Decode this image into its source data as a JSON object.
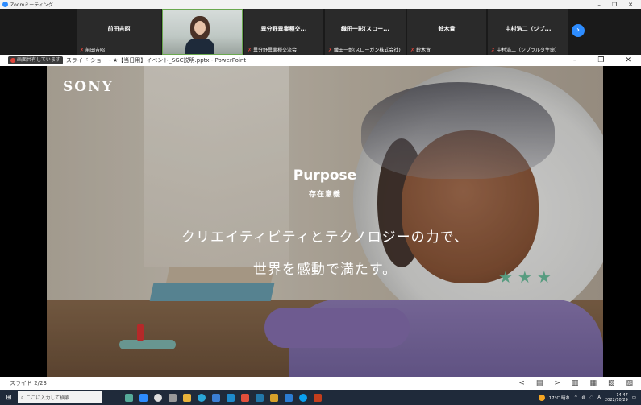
{
  "zoom": {
    "title": "Zoomミーティング",
    "window_controls": [
      "–",
      "❐",
      "✕"
    ],
    "participants": [
      {
        "name": "前田吉昭",
        "footer": "前田吉昭",
        "video": false
      },
      {
        "name": "",
        "footer": "",
        "video": true
      },
      {
        "name": "異分野異業種交...",
        "footer": "異分野異業種交流会",
        "video": false
      },
      {
        "name": "織田一彰(スロー...",
        "footer": "織田一彰(スローガン株式会社)",
        "video": false
      },
      {
        "name": "鈴木貴",
        "footer": "鈴木貴",
        "video": false
      },
      {
        "name": "中村浩二（ジプ...",
        "footer": "中村浩二（ジブラルタ生命）",
        "video": false
      }
    ],
    "next_icon": "chevron-right-icon"
  },
  "ppt": {
    "sharing_label": "画面共有しています",
    "doc_title": "スライド ショー - ★【当日用】イベント_SGC説明.pptx - PowerPoint",
    "window_controls": [
      "–",
      "❐",
      "✕"
    ],
    "slide": {
      "logo": "SONY",
      "heading": "Purpose",
      "subheading": "存在意義",
      "line1": "クリエイティビティとテクノロジーの力で、",
      "line2": "世界を感動で満たす。"
    },
    "status": {
      "slide_counter": "スライド 2/23",
      "controls": [
        "<",
        "▤",
        ">",
        "▥",
        "▦",
        "▧",
        "▨"
      ]
    }
  },
  "taskbar": {
    "start_icon": "windows-icon",
    "search_placeholder": "ここに入力して検索",
    "weather": "17°C 晴れ",
    "ime": "A",
    "time": "14:47",
    "date": "2022/10/29"
  }
}
